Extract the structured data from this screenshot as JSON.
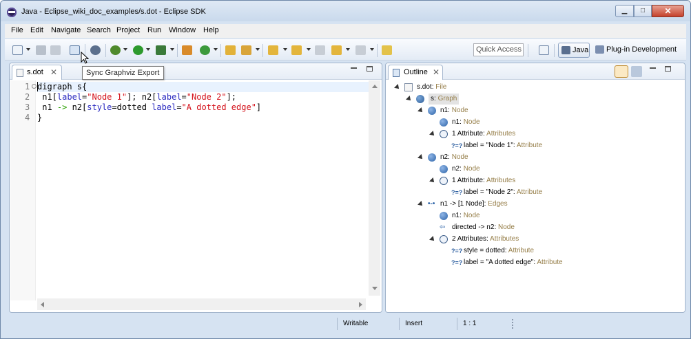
{
  "window": {
    "title": "Java - Eclipse_wiki_doc_examples/s.dot - Eclipse SDK",
    "min_glyph": "▁",
    "max_glyph": "□",
    "close_glyph": "✕"
  },
  "menu": [
    "File",
    "Edit",
    "Navigate",
    "Search",
    "Project",
    "Run",
    "Window",
    "Help"
  ],
  "toolbar": {
    "quick_access_placeholder": "Quick Access",
    "tooltip": "Sync Graphviz Export",
    "perspectives": [
      {
        "label": "Java",
        "active": true
      },
      {
        "label": "Plug-in Development",
        "active": false
      }
    ]
  },
  "editor": {
    "tab_label": "s.dot",
    "tab_close": "✕",
    "lines": [
      {
        "num": "1",
        "tokens": [
          {
            "t": "digraph s{",
            "c": "kw"
          }
        ]
      },
      {
        "num": "2",
        "tokens": [
          {
            "t": " n1[",
            "c": "kw"
          },
          {
            "t": "label",
            "c": "attr"
          },
          {
            "t": "=",
            "c": "kw"
          },
          {
            "t": "\"Node 1\"",
            "c": "str"
          },
          {
            "t": "]; n2[",
            "c": "kw"
          },
          {
            "t": "label",
            "c": "attr"
          },
          {
            "t": "=",
            "c": "kw"
          },
          {
            "t": "\"Node 2\"",
            "c": "str"
          },
          {
            "t": "];",
            "c": "kw"
          }
        ]
      },
      {
        "num": "3",
        "tokens": [
          {
            "t": " n1 ",
            "c": "kw"
          },
          {
            "t": "->",
            "c": "edge"
          },
          {
            "t": " n2[",
            "c": "kw"
          },
          {
            "t": "style",
            "c": "attr"
          },
          {
            "t": "=dotted ",
            "c": "kw"
          },
          {
            "t": "label",
            "c": "attr"
          },
          {
            "t": "=",
            "c": "kw"
          },
          {
            "t": "\"A dotted edge\"",
            "c": "str"
          },
          {
            "t": "]",
            "c": "kw"
          }
        ]
      },
      {
        "num": "4",
        "tokens": [
          {
            "t": "}",
            "c": "kw"
          }
        ]
      }
    ]
  },
  "outline": {
    "tab_label": "Outline",
    "tab_close": "✕",
    "rows": [
      {
        "depth": 0,
        "twisty": true,
        "icon": "file-icon",
        "name": "s.dot",
        "type": "File"
      },
      {
        "depth": 1,
        "twisty": true,
        "icon": "graph-icon",
        "name": "s",
        "type": "Graph",
        "selected": true
      },
      {
        "depth": 2,
        "twisty": true,
        "icon": "node-icon",
        "name": "n1",
        "type": "Node"
      },
      {
        "depth": 3,
        "twisty": false,
        "icon": "node-icon",
        "name": "n1",
        "type": "Node"
      },
      {
        "depth": 3,
        "twisty": true,
        "icon": "attributes-icon",
        "name": "1 Attribute",
        "type": "Attributes"
      },
      {
        "depth": 4,
        "twisty": false,
        "icon": "attribute-icon",
        "name": "label = \"Node 1\"",
        "type": "Attribute"
      },
      {
        "depth": 2,
        "twisty": true,
        "icon": "node-icon",
        "name": "n2",
        "type": "Node"
      },
      {
        "depth": 3,
        "twisty": false,
        "icon": "node-icon",
        "name": "n2",
        "type": "Node"
      },
      {
        "depth": 3,
        "twisty": true,
        "icon": "attributes-icon",
        "name": "1 Attribute",
        "type": "Attributes"
      },
      {
        "depth": 4,
        "twisty": false,
        "icon": "attribute-icon",
        "name": "label = \"Node 2\"",
        "type": "Attribute"
      },
      {
        "depth": 2,
        "twisty": true,
        "icon": "edges-icon",
        "name": "n1 -> [1 Node]",
        "type": "Edges"
      },
      {
        "depth": 3,
        "twisty": false,
        "icon": "node-icon",
        "name": "n1",
        "type": "Node"
      },
      {
        "depth": 3,
        "twisty": false,
        "icon": "directed-icon",
        "name": "directed -> n2",
        "type": "Node"
      },
      {
        "depth": 3,
        "twisty": true,
        "icon": "attributes-icon",
        "name": "2 Attributes",
        "type": "Attributes"
      },
      {
        "depth": 4,
        "twisty": false,
        "icon": "attribute-icon",
        "name": "style = dotted",
        "type": "Attribute"
      },
      {
        "depth": 4,
        "twisty": false,
        "icon": "attribute-icon",
        "name": "label = \"A dotted edge\"",
        "type": "Attribute"
      }
    ]
  },
  "statusbar": {
    "writable": "Writable",
    "insert": "Insert",
    "position": "1 : 1"
  },
  "colors": {
    "type_label": "#957d47",
    "string": "#d4111a",
    "attribute": "#2a2ac0",
    "edge_op": "#2aa000"
  }
}
